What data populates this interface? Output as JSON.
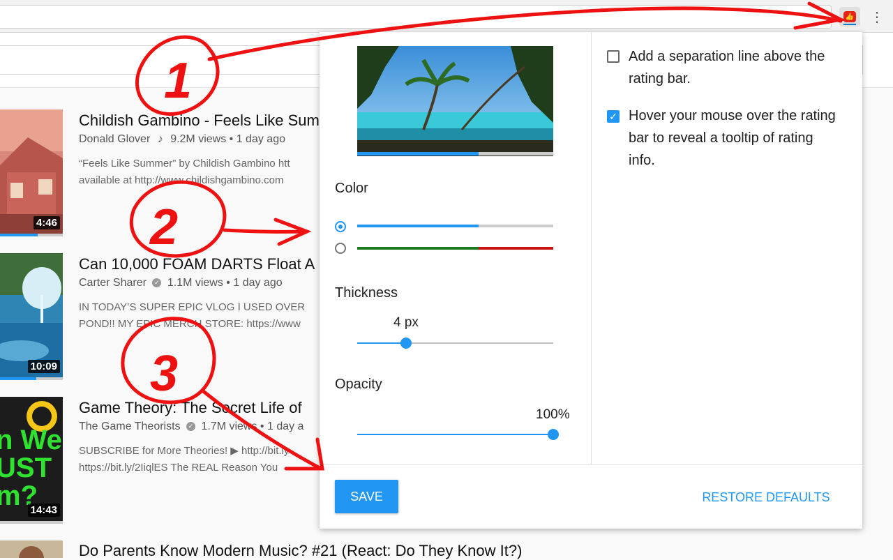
{
  "videos": [
    {
      "title": "Childish Gambino - Feels Like Summer",
      "channel": "Donald Glover",
      "channel_badge": "music-note-icon",
      "meta": "9.2M views • 1 day ago",
      "desc": "“Feels Like Summer” by Childish Gambino htt\navailable at http://www.childishgambino.com",
      "duration": "4:46"
    },
    {
      "title": "Can 10,000 FOAM DARTS Float A",
      "channel": "Carter Sharer",
      "channel_badge": "verified-icon",
      "meta": "1.1M views • 1 day ago",
      "desc": "IN TODAY’S SUPER EPIC VLOG I USED OVER \nPOND!! MY EPIC MERCH STORE: https://www",
      "duration": "10:09"
    },
    {
      "title": "Game Theory: The Secret Life of",
      "channel": "The Game Theorists",
      "channel_badge": "verified-icon",
      "meta": "1.7M views • 1 day a",
      "desc": "SUBSCRIBE for More Theories! ▶ http://bit.ly\nhttps://bit.ly/2IiqlES The REAL Reason You",
      "duration": "14:43",
      "thumb_text": "n We\nUST\nm?"
    },
    {
      "title": "Do Parents Know Modern Music? #21 (React: Do They Know It?)"
    }
  ],
  "popup": {
    "color_label": "Color",
    "thickness_label": "Thickness",
    "thickness_value": "4 px",
    "thickness_fraction": 0.25,
    "opacity_label": "Opacity",
    "opacity_value": "100%",
    "opacity_fraction": 1.0,
    "preview_rating_fraction": 0.62,
    "color_options": [
      {
        "selected": true,
        "like": "#2196f3",
        "dislike": "#cccccc"
      },
      {
        "selected": false,
        "like": "#1b7a1b",
        "dislike": "#cc1111"
      }
    ],
    "options": [
      {
        "checked": false,
        "label": "Add a separation line above the rating bar."
      },
      {
        "checked": true,
        "label": "Hover your mouse over the rating bar to reveal a tooltip of rating info."
      }
    ],
    "save_label": "SAVE",
    "restore_label": "RESTORE DEFAULTS"
  },
  "annotations": [
    "1",
    "2",
    "3"
  ],
  "colors": {
    "accent": "#2196f3",
    "annotation": "#ee1111",
    "extension": "#e62117"
  }
}
